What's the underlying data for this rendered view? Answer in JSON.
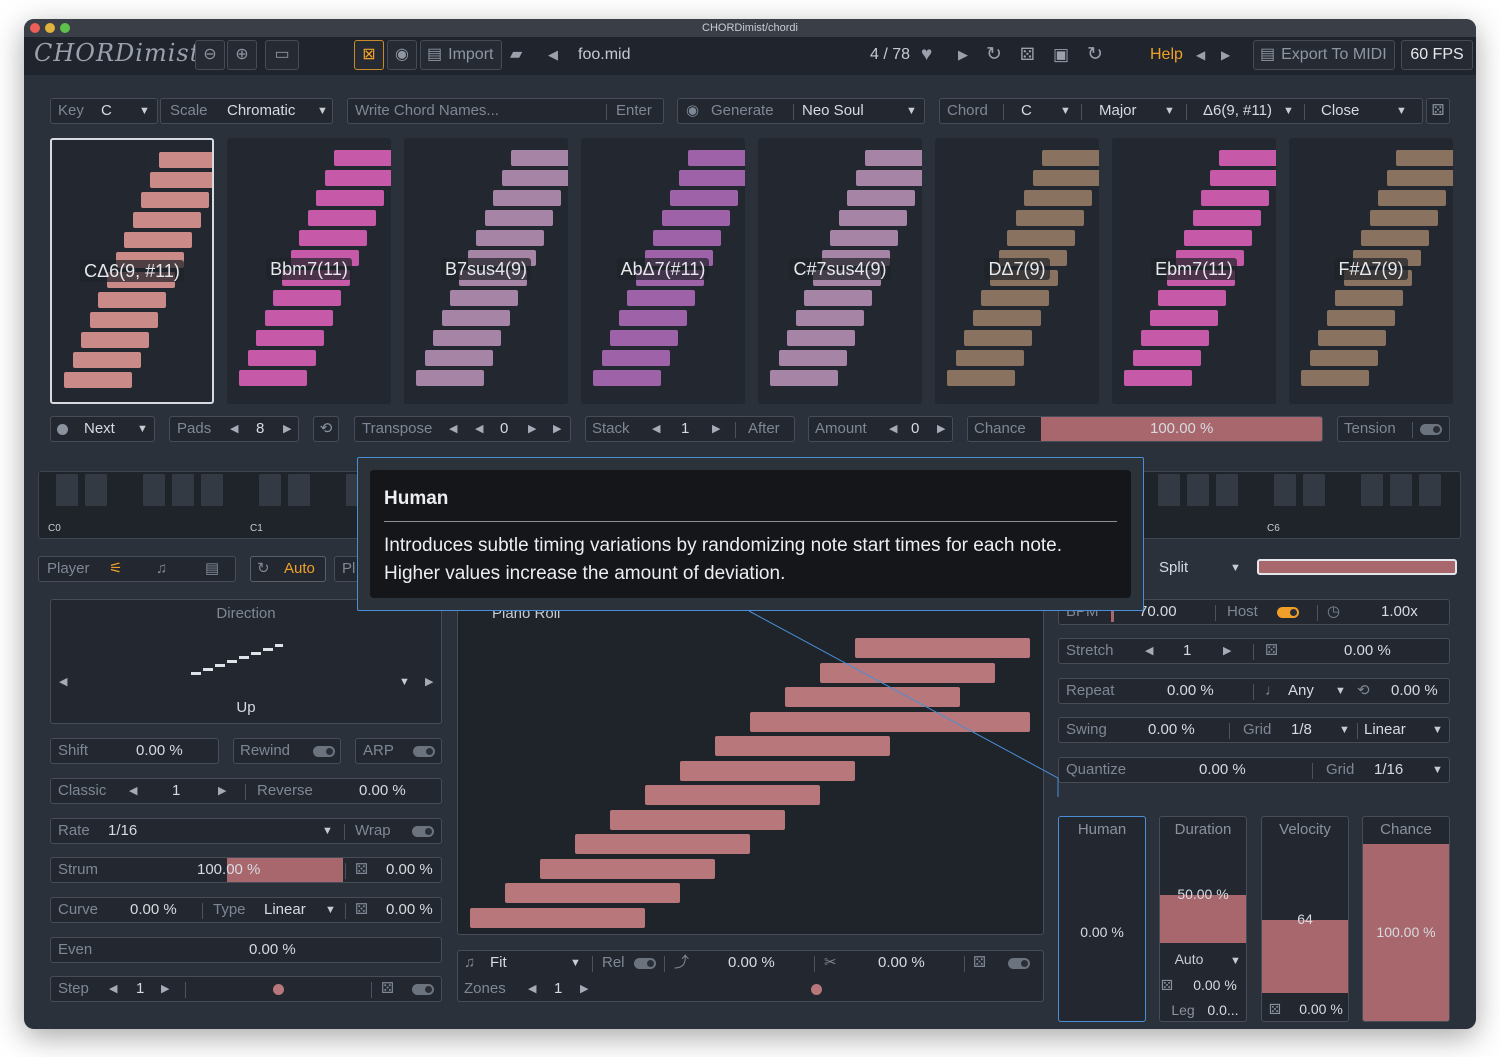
{
  "window": {
    "title": "CHORDimist/chordi"
  },
  "toolbar": {
    "logo": "CHORDimist",
    "import_label": "Import",
    "file_name": "foo.mid",
    "counter": "4 / 78",
    "help_label": "Help",
    "export_label": "Export To MIDI",
    "fps": "60 FPS"
  },
  "controls": {
    "key_label": "Key",
    "key_value": "C",
    "scale_label": "Scale",
    "scale_value": "Chromatic",
    "chord_names_placeholder": "Write Chord Names...",
    "enter_label": "Enter",
    "generate_label": "Generate",
    "generate_value": "Neo Soul",
    "chord_label": "Chord",
    "chord_root": "C",
    "chord_quality": "Major",
    "chord_ext": "Δ6(9, #11)",
    "voicing": "Close"
  },
  "pads": [
    {
      "name": "CΔ6(9, #11)",
      "color": "#c98a88",
      "selected": true
    },
    {
      "name": "Bbm7(11)",
      "color": "#c75aa8"
    },
    {
      "name": "B7sus4(9)",
      "color": "#a584a6"
    },
    {
      "name": "AbΔ7(#11)",
      "color": "#9e62a8"
    },
    {
      "name": "C#7sus4(9)",
      "color": "#a584a6"
    },
    {
      "name": "DΔ7(9)",
      "color": "#8a7260"
    },
    {
      "name": "Ebm7(11)",
      "color": "#c75aa8"
    },
    {
      "name": "F#Δ7(9)",
      "color": "#8a7260"
    }
  ],
  "padbar": {
    "next_label": "Next",
    "pads_label": "Pads",
    "pads_value": "8",
    "transpose_label": "Transpose",
    "transpose_value": "0",
    "stack_label": "Stack",
    "stack_value": "1",
    "after_label": "After",
    "amount_label": "Amount",
    "amount_value": "0",
    "chance_label": "Chance",
    "chance_value": "100.00 %",
    "chance_fraction": 1.0,
    "tension_label": "Tension"
  },
  "keyboard": {
    "c0": "C0",
    "c1": "C1",
    "c6": "C6"
  },
  "player": {
    "player_label": "Player",
    "auto_label": "Auto",
    "pl_label": "Pl",
    "split_label": "Split"
  },
  "tooltip": {
    "title": "Human",
    "body_line1": "Introduces subtle timing variations by randomizing note start times for each note.",
    "body_line2": "Higher values increase the amount of deviation."
  },
  "left": {
    "direction_title": "Direction",
    "direction_value": "Up",
    "shift_label": "Shift",
    "shift_value": "0.00 %",
    "rewind_label": "Rewind",
    "arp_label": "ARP",
    "classic_label": "Classic",
    "classic_value": "1",
    "reverse_label": "Reverse",
    "reverse_value": "0.00 %",
    "rate_label": "Rate",
    "rate_value": "1/16",
    "wrap_label": "Wrap",
    "strum_label": "Strum",
    "strum_value": "100.00 %",
    "strum_rand": "0.00 %",
    "curve_label": "Curve",
    "curve_value": "0.00 %",
    "type_label": "Type",
    "type_value": "Linear",
    "curve_rand": "0.00 %",
    "even_label": "Even",
    "even_value": "0.00 %",
    "step_label": "Step",
    "step_value": "1"
  },
  "center": {
    "view_label": "Piano Roll",
    "fit_label": "Fit",
    "rel_label": "Rel",
    "val1": "0.00 %",
    "val2": "0.00 %",
    "zones_label": "Zones",
    "zones_value": "1"
  },
  "right": {
    "bpm_label": "BPM",
    "bpm_value": "70.00",
    "host_label": "Host",
    "speed_value": "1.00x",
    "stretch_label": "Stretch",
    "stretch_value": "1",
    "stretch_pct": "0.00 %",
    "repeat_label": "Repeat",
    "repeat_value": "0.00 %",
    "any_label": "Any",
    "repeat_pct": "0.00 %",
    "swing_label": "Swing",
    "swing_value": "0.00 %",
    "grid_label": "Grid",
    "swing_grid": "1/8",
    "swing_type": "Linear",
    "quantize_label": "Quantize",
    "quantize_value": "0.00 %",
    "quantize_grid": "1/16",
    "human_label": "Human",
    "human_value": "0.00 %",
    "duration_label": "Duration",
    "duration_value": "50.00 %",
    "duration_mode": "Auto",
    "duration_rand": "0.00 %",
    "leg_label": "Leg",
    "leg_value": "0.0...",
    "velocity_label": "Velocity",
    "velocity_value": "64",
    "velocity_rand": "0.00 %",
    "chance_label": "Chance",
    "chance_value": "100.00 %"
  },
  "colors": {
    "accent": "#f0a028",
    "bar": "#b7777b",
    "focus": "#4a8fd6"
  }
}
